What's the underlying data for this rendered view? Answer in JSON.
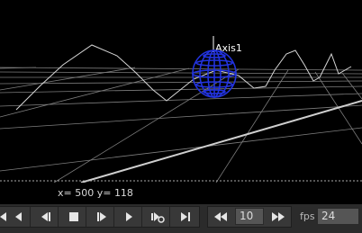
{
  "viewer": {
    "axis_label": "Axis1",
    "coords_text": "x= 500 y= 118"
  },
  "transport": {
    "buttons": [
      {
        "name": "first-frame-button",
        "icon": "skip-to-start-icon"
      },
      {
        "name": "prev-keyframe-button",
        "icon": "prev-keyframe-icon"
      },
      {
        "name": "step-back-button",
        "icon": "step-back-icon"
      },
      {
        "name": "play-backward-button",
        "icon": "play-backward-icon"
      },
      {
        "name": "stop-button",
        "icon": "stop-icon"
      },
      {
        "name": "play-forward-button",
        "icon": "play-forward-icon"
      },
      {
        "name": "step-forward-button",
        "icon": "step-forward-icon"
      },
      {
        "name": "next-keyframe-button",
        "icon": "next-keyframe-icon"
      },
      {
        "name": "last-frame-button",
        "icon": "skip-to-end-icon"
      }
    ],
    "increment_value": "10",
    "fps_label": "fps",
    "fps_value": "24"
  },
  "colors": {
    "wire": "#1f2fd8",
    "grid": "#8a8a8a",
    "toolbar_bg": "#2b2b2b",
    "button_bg": "#383838",
    "icon": "#e6e6e6"
  }
}
